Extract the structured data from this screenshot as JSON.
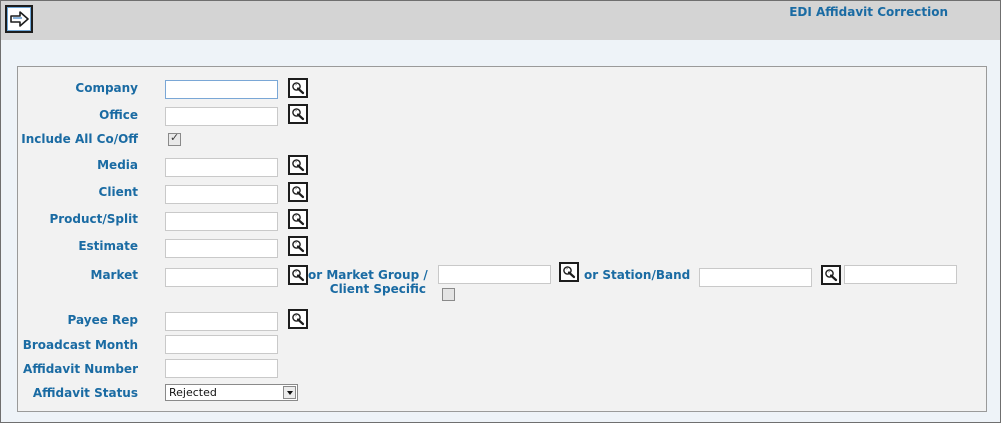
{
  "header": {
    "title": "EDI Affidavit Correction",
    "go_button_icon": "arrow-right-icon"
  },
  "form": {
    "company": {
      "label": "Company",
      "value": ""
    },
    "office": {
      "label": "Office",
      "value": ""
    },
    "include_all": {
      "label": "Include All Co/Off",
      "checked": true
    },
    "media": {
      "label": "Media",
      "value": ""
    },
    "client": {
      "label": "Client",
      "value": ""
    },
    "product_split": {
      "label": "Product/Split",
      "value": ""
    },
    "estimate": {
      "label": "Estimate",
      "value": ""
    },
    "market": {
      "label": "Market",
      "value": ""
    },
    "market_group": {
      "label_line1": "or Market Group /",
      "label_line2": "Client Specific",
      "value": "",
      "client_specific_checked": false
    },
    "station_band": {
      "label": "or Station/Band",
      "value": "",
      "value2": ""
    },
    "payee_rep": {
      "label": "Payee Rep",
      "value": ""
    },
    "broadcast_month": {
      "label": "Broadcast Month",
      "value": ""
    },
    "affidavit_number": {
      "label": "Affidavit Number",
      "value": ""
    },
    "affidavit_status": {
      "label": "Affidavit Status",
      "value": "Rejected"
    }
  },
  "icons": {
    "lookup": "magnifier-lookup-icon"
  },
  "colors": {
    "label": "#1a6ba3",
    "header_bg": "#d4d4d4",
    "panel_bg": "#f2f2f2",
    "page_bg": "#eef3f8"
  }
}
